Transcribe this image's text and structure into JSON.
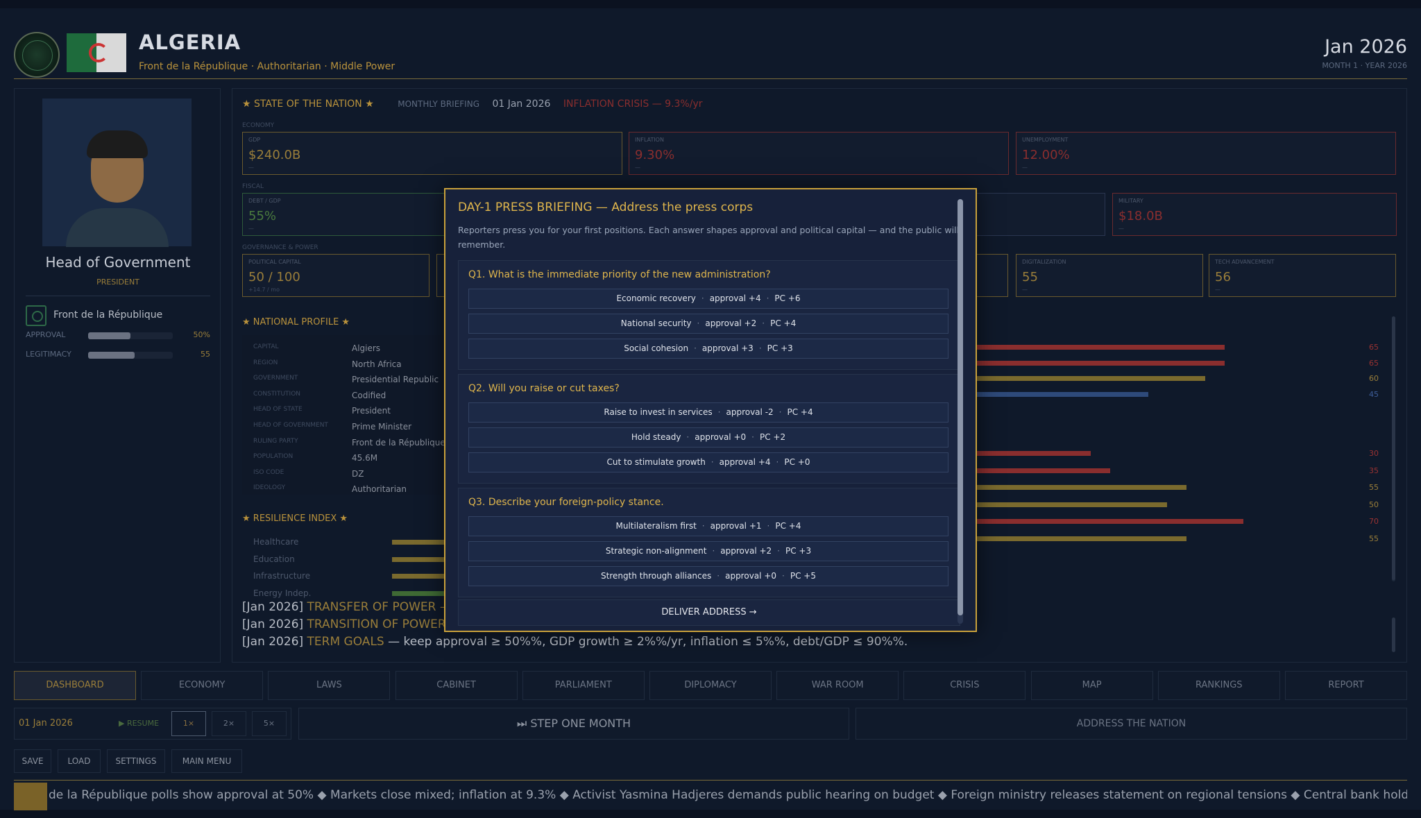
{
  "header": {
    "country": "ALGERIA",
    "subtitle": "Front de la République · Authoritarian · Middle Power",
    "date": "Jan 2026",
    "month": "MONTH 1 · YEAR 2026"
  },
  "leader": {
    "title": "Head of Government",
    "role": "PRESIDENT",
    "party": "Front de la République",
    "approval_label": "APPROVAL",
    "approval_value": "50%",
    "approval_fraction": 0.5,
    "legitimacy_label": "LEGITIMACY",
    "legitimacy_value": "55",
    "legitimacy_fraction": 0.55
  },
  "briefing": {
    "title": "STATE OF THE NATION",
    "sub": "MONTHLY BRIEFING",
    "date": "01 Jan 2026",
    "crisis": "INFLATION CRISIS — 9.3%/yr"
  },
  "sections": {
    "economy": "ECONOMY",
    "fiscal": "FISCAL",
    "governance": "GOVERNANCE & POWER"
  },
  "cards": {
    "gdp": {
      "label": "GDP",
      "value": "$240.0B",
      "sub": "—"
    },
    "inflation": {
      "label": "INFLATION",
      "value": "9.30%",
      "sub": "—"
    },
    "unemployment": {
      "label": "UNEMPLOYMENT",
      "value": "12.00%",
      "sub": "—"
    },
    "debt": {
      "label": "DEBT / GDP",
      "value": "55%",
      "sub": "—"
    },
    "military": {
      "label": "MILITARY",
      "value": "$18.0B",
      "sub": "—"
    },
    "pc": {
      "label": "POLITICAL CAPITAL",
      "value": "50 / 100",
      "sub": "+14.7 / mo"
    },
    "digital": {
      "label": "DIGITALIZATION",
      "value": "55",
      "sub": "—"
    },
    "tech": {
      "label": "TECH ADVANCEMENT",
      "value": "56",
      "sub": "—"
    }
  },
  "profile": {
    "title": "NATIONAL PROFILE",
    "rows": [
      {
        "k": "CAPITAL",
        "v": "Algiers"
      },
      {
        "k": "REGION",
        "v": "North Africa"
      },
      {
        "k": "GOVERNMENT",
        "v": "Presidential Republic"
      },
      {
        "k": "CONSTITUTION",
        "v": "Codified"
      },
      {
        "k": "HEAD OF STATE",
        "v": "President"
      },
      {
        "k": "HEAD OF GOVERNMENT",
        "v": "Prime Minister"
      },
      {
        "k": "RULING PARTY",
        "v": "Front de la République"
      },
      {
        "k": "POPULATION",
        "v": "45.6M"
      },
      {
        "k": "ISO CODE",
        "v": "DZ"
      },
      {
        "k": "IDEOLOGY",
        "v": "Authoritarian"
      }
    ]
  },
  "resilience": {
    "title": "RESILIENCE INDEX",
    "rows": [
      "Healthcare",
      "Education",
      "Infrastructure",
      "Energy Indep."
    ]
  },
  "bars_a": [
    {
      "value": 65,
      "label": "65",
      "color": "#8a2e2e"
    },
    {
      "value": 65,
      "label": "65",
      "color": "#8a2e2e"
    },
    {
      "value": 60,
      "label": "60",
      "color": "#7a6a2e"
    },
    {
      "value": 45,
      "label": "45",
      "color": "#2e4a7a"
    }
  ],
  "bars_b": [
    {
      "value": 30,
      "label": "30",
      "color": "#8a2e2e"
    },
    {
      "value": 35,
      "label": "35",
      "color": "#8a2e2e"
    },
    {
      "value": 55,
      "label": "55",
      "color": "#7a6a2e"
    },
    {
      "value": 50,
      "label": "50",
      "color": "#7a6a2e"
    },
    {
      "value": 70,
      "label": "70",
      "color": "#8a2e2e"
    },
    {
      "value": 55,
      "label": "55",
      "color": "#7a6a2e"
    }
  ],
  "log": {
    "l1_date": "[Jan 2026]",
    "l1_title": "TRANSFER OF POWER —",
    "l2_date": "[Jan 2026]",
    "l2_title": "TRANSITION OF POWER —",
    "l3_date": "[Jan 2026]",
    "l3_title": "TERM GOALS",
    "l3_text": "— keep approval ≥ 50%%, GDP growth ≥ 2%%/yr, inflation ≤ 5%%, debt/GDP ≤ 90%%."
  },
  "tabs": [
    "DASHBOARD",
    "ECONOMY",
    "LAWS",
    "CABINET",
    "PARLIAMENT",
    "DIPLOMACY",
    "WAR ROOM",
    "CRISIS",
    "MAP",
    "RANKINGS",
    "REPORT"
  ],
  "controls": {
    "date": "01 Jan 2026",
    "resume": "▶ RESUME",
    "speeds": [
      "1×",
      "2×",
      "5×"
    ],
    "step": "⏭ STEP ONE MONTH",
    "address": "ADDRESS THE NATION",
    "save": "SAVE",
    "load": "LOAD",
    "settings": "SETTINGS",
    "main_menu": "MAIN MENU"
  },
  "ticker": "de la République polls show approval at 50%   ◆   Markets close mixed; inflation at 9.3%   ◆   Activist Yasmina Hadjeres demands public hearing on budget   ◆   Foreign ministry releases statement on regional tensions   ◆   Central bank holds",
  "modal": {
    "title": "DAY-1 PRESS BRIEFING — Address the press corps",
    "desc": "Reporters press you for your first positions. Each answer shapes approval and political capital — and the public will remember.",
    "questions": [
      {
        "q": "Q1.  What is the immediate priority of the new administration?",
        "options": [
          {
            "label": "Economic recovery",
            "approval": "approval +4",
            "pc": "PC +6"
          },
          {
            "label": "National security",
            "approval": "approval +2",
            "pc": "PC +4"
          },
          {
            "label": "Social cohesion",
            "approval": "approval +3",
            "pc": "PC +3"
          }
        ]
      },
      {
        "q": "Q2.  Will you raise or cut taxes?",
        "options": [
          {
            "label": "Raise to invest in services",
            "approval": "approval -2",
            "pc": "PC +4"
          },
          {
            "label": "Hold steady",
            "approval": "approval +0",
            "pc": "PC +2"
          },
          {
            "label": "Cut to stimulate growth",
            "approval": "approval +4",
            "pc": "PC +0"
          }
        ]
      },
      {
        "q": "Q3.  Describe your foreign-policy stance.",
        "options": [
          {
            "label": "Multilateralism first",
            "approval": "approval +1",
            "pc": "PC +4"
          },
          {
            "label": "Strategic non-alignment",
            "approval": "approval +2",
            "pc": "PC +3"
          },
          {
            "label": "Strength through alliances",
            "approval": "approval +0",
            "pc": "PC +5"
          }
        ]
      }
    ],
    "deliver": "DELIVER ADDRESS →"
  }
}
